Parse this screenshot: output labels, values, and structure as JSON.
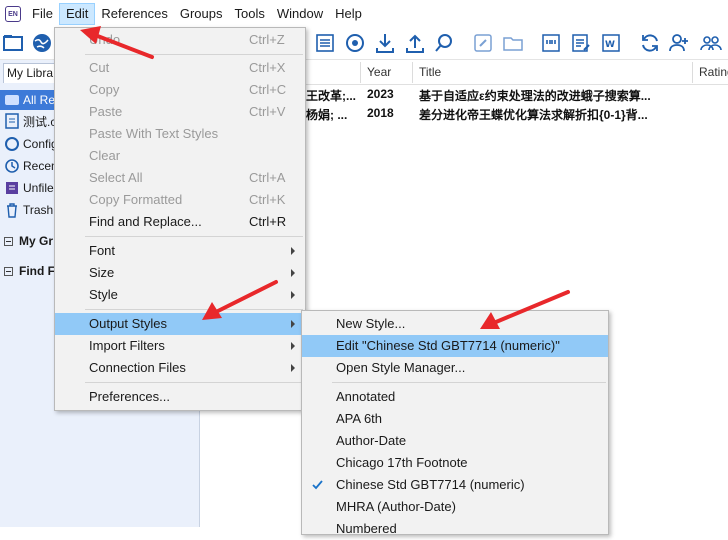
{
  "menubar": {
    "logo_text": "EN",
    "items": [
      "File",
      "Edit",
      "References",
      "Groups",
      "Tools",
      "Window",
      "Help"
    ]
  },
  "toolbar": {
    "icons": [
      "new-library-icon",
      "online-search-icon",
      "insert-citation-icon",
      "find-fulltext-icon",
      "import-icon",
      "export-icon",
      "search-icon",
      "url-link-icon",
      "open-folder-icon",
      "quote-icon",
      "format-bibliography-icon",
      "word-icon",
      "sync-icon",
      "share-icon",
      "group-icon"
    ]
  },
  "left_panel": {
    "tab_label": "My Libra",
    "items": [
      {
        "label": "All Re"
      },
      {
        "label": "测试.c"
      },
      {
        "label": "Config"
      },
      {
        "label": "Recen"
      },
      {
        "label": "Unfile"
      },
      {
        "label": "Trash"
      }
    ],
    "groups": [
      {
        "label": "My Gr"
      },
      {
        "label": "Find F"
      }
    ]
  },
  "reference_list": {
    "columns": [
      "Year",
      "Title",
      "Rating"
    ],
    "rows": [
      {
        "author": "王改革;...",
        "year": "2023",
        "title": "基于自适应ε约束处理法的改进蛾子搜索算..."
      },
      {
        "author": "杨娟; ...",
        "year": "2018",
        "title": "差分进化帝王蝶优化算法求解折扣{0-1}背..."
      }
    ]
  },
  "edit_menu": {
    "items": [
      {
        "label": "Undo",
        "shortcut": "Ctrl+Z"
      },
      {
        "label": "Cut",
        "shortcut": "Ctrl+X"
      },
      {
        "label": "Copy",
        "shortcut": "Ctrl+C"
      },
      {
        "label": "Paste",
        "shortcut": "Ctrl+V"
      },
      {
        "label": "Paste With Text Styles",
        "shortcut": ""
      },
      {
        "label": "Clear",
        "shortcut": ""
      },
      {
        "label": "Select All",
        "shortcut": "Ctrl+A"
      },
      {
        "label": "Copy Formatted",
        "shortcut": "Ctrl+K"
      },
      {
        "label": "Find and Replace...",
        "shortcut": "Ctrl+R"
      },
      {
        "label": "Font"
      },
      {
        "label": "Size"
      },
      {
        "label": "Style"
      },
      {
        "label": "Output Styles"
      },
      {
        "label": "Import Filters"
      },
      {
        "label": "Connection Files"
      },
      {
        "label": "Preferences..."
      }
    ]
  },
  "output_styles_menu": {
    "items": [
      {
        "label": "New Style..."
      },
      {
        "label": "Edit \"Chinese Std GBT7714 (numeric)\""
      },
      {
        "label": "Open Style Manager..."
      },
      {
        "label": "Annotated"
      },
      {
        "label": "APA 6th"
      },
      {
        "label": "Author-Date"
      },
      {
        "label": "Chicago 17th Footnote"
      },
      {
        "label": "Chinese Std GBT7714 (numeric)"
      },
      {
        "label": "MHRA (Author-Date)"
      },
      {
        "label": "Numbered"
      }
    ]
  },
  "colors": {
    "highlight": "#91c9f7",
    "selected": "#3d7ad8",
    "arrow": "#e8282b"
  }
}
